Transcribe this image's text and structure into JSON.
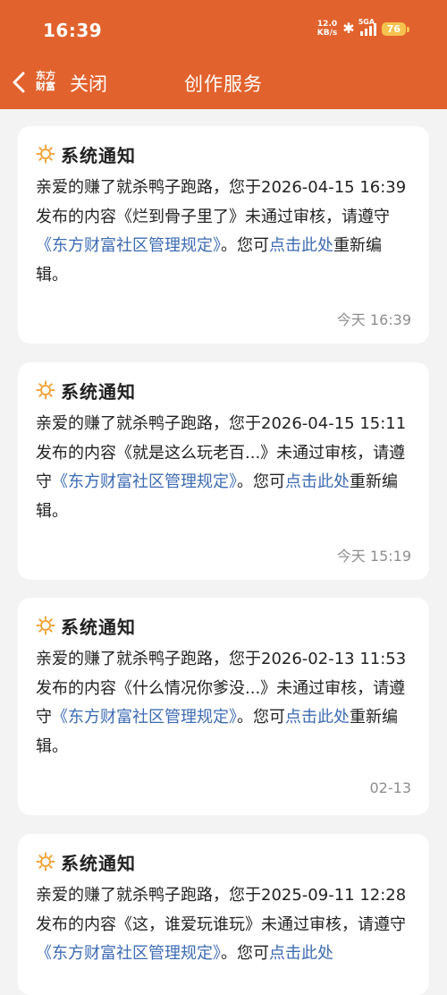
{
  "status_bar": {
    "time": "16:39",
    "net_speed_value": "12.0",
    "net_speed_unit": "KB/s",
    "network": "5GA",
    "battery": "76"
  },
  "nav": {
    "logo_line1": "东方",
    "logo_line2": "财富",
    "close_label": "关闭",
    "title": "创作服务"
  },
  "notices": [
    {
      "title": "系统通知",
      "text_before": "亲爱的赚了就杀鸭子跑路，您于2026-04-15 16:39发布的内容《烂到骨子里了》未通过审核，请遵守",
      "rules_link": "《东方财富社区管理规定》",
      "text_middle": "。您可",
      "edit_link": "点击此处",
      "text_after": "重新编辑。",
      "time": "今天 16:39"
    },
    {
      "title": "系统通知",
      "text_before": "亲爱的赚了就杀鸭子跑路，您于2026-04-15 15:11发布的内容《就是这么玩老百...》未通过审核，请遵守",
      "rules_link": "《东方财富社区管理规定》",
      "text_middle": "。您可",
      "edit_link": "点击此处",
      "text_after": "重新编辑。",
      "time": "今天 15:19"
    },
    {
      "title": "系统通知",
      "text_before": "亲爱的赚了就杀鸭子跑路，您于2026-02-13 11:53发布的内容《什么情况你爹没...》未通过审核，请遵守",
      "rules_link": "《东方财富社区管理规定》",
      "text_middle": "。您可",
      "edit_link": "点击此处",
      "text_after": "重新编辑。",
      "time": "02-13"
    },
    {
      "title": "系统通知",
      "text_before": "亲爱的赚了就杀鸭子跑路，您于2025-09-11 12:28发布的内容《这，谁爱玩谁玩》未通过审核，请遵守",
      "rules_link": "《东方财富社区管理规定》",
      "text_middle": "。您可",
      "edit_link": "点击此处",
      "text_after": "",
      "time": ""
    }
  ],
  "colors": {
    "header": "#e2622d",
    "link": "#3d6bb3",
    "icon": "#f2a33a",
    "background": "#f3f3f3"
  },
  "icons": {
    "back": "chevron-left-icon",
    "logo": "eastmoney-logo-icon",
    "notice": "sun-notice-icon",
    "bluetooth": "bluetooth-icon",
    "signal": "signal-icon",
    "battery": "battery-icon"
  }
}
